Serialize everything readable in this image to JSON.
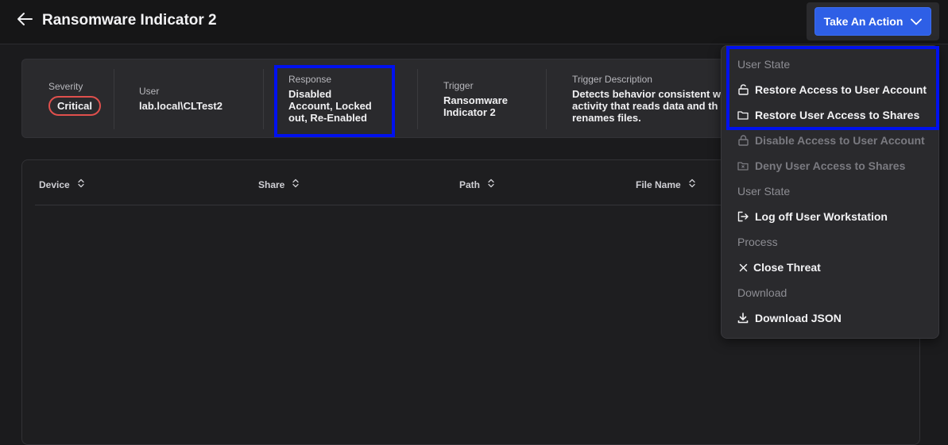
{
  "header": {
    "title": "Ransomware Indicator 2",
    "action_label": "Take An Action"
  },
  "summary": {
    "severity": {
      "label": "Severity",
      "value": "Critical"
    },
    "user": {
      "label": "User",
      "value": "lab.local\\CLTest2"
    },
    "response": {
      "label": "Response",
      "lines": [
        "Disabled",
        "Account, Locked",
        "out, Re-Enabled"
      ]
    },
    "trigger": {
      "label": "Trigger",
      "lines": [
        "Ransomware",
        "Indicator 2"
      ]
    },
    "trigger_description": {
      "label": "Trigger Description",
      "lines": [
        "Detects behavior consistent w",
        "activity that reads data and th",
        "renames files."
      ]
    }
  },
  "table": {
    "columns": [
      "Device",
      "Share",
      "Path",
      "File Name"
    ]
  },
  "menu": {
    "section1": "User State",
    "restore_account": "Restore Access to User Account",
    "restore_shares": "Restore User Access to Shares",
    "disable_account": "Disable Access to User Account",
    "deny_shares": "Deny User Access to Shares",
    "section2": "User State",
    "logoff": "Log off User Workstation",
    "section3": "Process",
    "close_threat": "Close Threat",
    "section4": "Download",
    "download_json": "Download JSON"
  },
  "colors": {
    "accent": "#2e5fe6",
    "critical": "#e0504d",
    "highlight": "#0011ee"
  },
  "icons": [
    "back-arrow-icon",
    "chevron-down-icon",
    "sort-icon",
    "unlock-icon",
    "folder-icon",
    "lock-icon",
    "folder-x-icon",
    "logout-icon",
    "close-icon",
    "download-icon"
  ]
}
